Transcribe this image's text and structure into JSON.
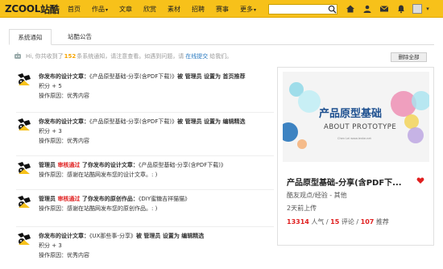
{
  "header": {
    "logo_text": "ZCOOL",
    "logo_cn": "站酷",
    "nav": [
      {
        "label": "首页",
        "caret": ""
      },
      {
        "label": "作品",
        "caret": "▾"
      },
      {
        "label": "文章",
        "caret": ""
      },
      {
        "label": "欣赏",
        "caret": ""
      },
      {
        "label": "素材",
        "caret": ""
      },
      {
        "label": "招聘",
        "caret": ""
      },
      {
        "label": "赛事",
        "caret": ""
      },
      {
        "label": "更多",
        "caret": "▾"
      }
    ],
    "search_placeholder": "",
    "icons": [
      "search-icon",
      "home-icon",
      "user-group-icon",
      "mail-icon",
      "bell-icon",
      "avatar",
      "chevron-down-icon"
    ]
  },
  "tabs": [
    {
      "label": "系统通知",
      "active": true
    },
    {
      "label": "站酷公告",
      "active": false
    }
  ],
  "info": {
    "prefix": "Hi, 你共收到了",
    "count": "152",
    "middle": "条系统通知，请注意查看。如遇到问题，请",
    "link": "在线提交",
    "suffix": "给我们。",
    "delete_all": "删除全部"
  },
  "notifications": [
    {
      "line1": [
        {
          "t": "你发布的设计文章：",
          "c": "hl"
        },
        {
          "t": "《产品原型基础-分享(含PDF下载)》",
          "c": ""
        },
        {
          "t": "被 管理员 设置为 首页推荐",
          "c": "hl"
        }
      ],
      "line2": "积分 + 5",
      "line3": "操作原因：优秀内容"
    },
    {
      "line1": [
        {
          "t": "你发布的设计文章：",
          "c": "hl"
        },
        {
          "t": "《产品原型基础-分享(含PDF下载)》",
          "c": ""
        },
        {
          "t": "被 管理员 设置为 编辑精选",
          "c": "hl"
        }
      ],
      "line2": "积分 + 3",
      "line3": "操作原因：优秀内容"
    },
    {
      "line1": [
        {
          "t": "管理员 ",
          "c": "hl"
        },
        {
          "t": "审核通过",
          "c": "red"
        },
        {
          "t": " 了你发布的设计文章：",
          "c": "hl"
        },
        {
          "t": "《产品原型基础-分享(含PDF下载)》",
          "c": ""
        }
      ],
      "line2": "操作原因：感谢在站酷网发布您的设计文章。: )",
      "line3": ""
    },
    {
      "line1": [
        {
          "t": "管理员 ",
          "c": "hl"
        },
        {
          "t": "审核通过",
          "c": "red"
        },
        {
          "t": " 了你发布的原创作品：",
          "c": "hl"
        },
        {
          "t": "《DIY蜜糖吉祥猫猫》",
          "c": ""
        }
      ],
      "line2": "操作原因：感谢在站酷网发布您的原创作品。: )",
      "line3": ""
    },
    {
      "line1": [
        {
          "t": "你发布的设计文章：",
          "c": "hl"
        },
        {
          "t": "《UX那些事-分享》",
          "c": ""
        },
        {
          "t": "被 管理员 设置为 编辑精选",
          "c": "hl"
        }
      ],
      "line2": "积分 + 3",
      "line3": "操作原因：优秀内容"
    }
  ],
  "card": {
    "image_title_cn": "产品原型基础",
    "image_title_en": "ABOUT PROTOTYPE",
    "image_small": "Chen Lei    www.lenke.net",
    "title": "产品原型基础-分享(含PDF下...",
    "category": "酷友观点/经验 - 其他",
    "time": "2天前上传",
    "views": "13314",
    "views_label": "人气",
    "comments": "15",
    "comments_label": "评论",
    "recs": "107",
    "recs_label": "推荐",
    "sep": " / "
  },
  "colors": {
    "brand_yellow": "#f7c11a",
    "accent_red": "#e02020",
    "link_blue": "#2a7ac0"
  }
}
